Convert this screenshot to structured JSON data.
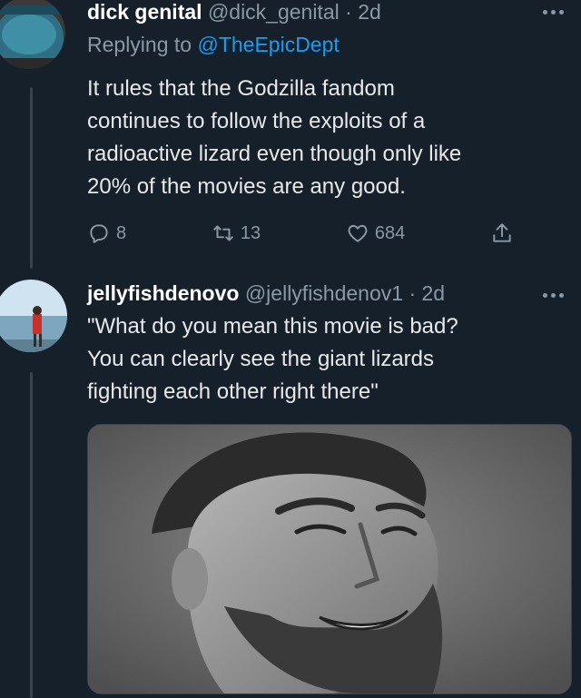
{
  "tweet1": {
    "display_name": "dick genital",
    "handle": "@dick_genital",
    "separator": "·",
    "age": "2d",
    "replying_prefix": "Replying to ",
    "replying_handle": "@TheEpicDept",
    "text_lines": [
      "It rules that the Godzilla fandom",
      "continues to follow the exploits of a",
      "radioactive lizard even though only like",
      "20% of the movies are any good."
    ],
    "reply_count": "8",
    "retweet_count": "13",
    "like_count": "684"
  },
  "tweet2": {
    "display_name": "jellyfishdenovo",
    "handle": "@jellyfishdenov1",
    "separator": "·",
    "age": "2d",
    "text_lines": [
      "\"What do you mean this movie is bad?",
      "You can clearly see the giant lizards",
      "fighting each other right there\""
    ]
  },
  "colors": {
    "background": "#15202b",
    "muted": "#8b98a5",
    "link": "#1d9bf0",
    "text": "#e7e9ea"
  },
  "icons": {
    "reply": "reply-icon",
    "retweet": "retweet-icon",
    "like": "heart-icon",
    "share": "share-icon",
    "more": "more-icon"
  }
}
